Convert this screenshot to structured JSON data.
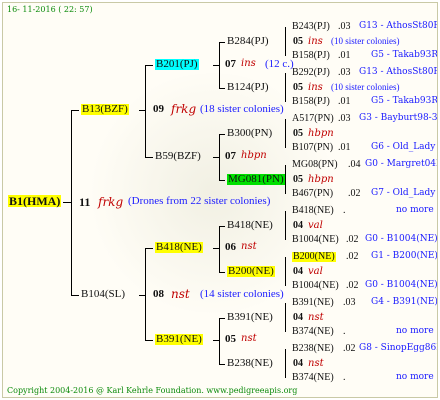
{
  "date": "16- 11-2016 ( 22: 57)",
  "footer": "Copyright 2004-2016 @ Karl Kehrle Foundation.   www.pedigreeapis.org",
  "root": {
    "id": "B1(HMA)",
    "num": "11",
    "name": "frkg",
    "note": "(Drones from 22 sister colonies)"
  },
  "gen1": [
    {
      "id": "B13(BZF)",
      "num": "09",
      "name": "frkg",
      "note": "(18 sister colonies)"
    },
    {
      "id": "B104(SL)",
      "num": "08",
      "name": "nst",
      "note": "(14 sister colonies)"
    }
  ],
  "gen2": [
    {
      "id": "B201(PJ)",
      "num": "07",
      "name": "ins",
      "note": "(12 c.)"
    },
    {
      "id": "B59(BZF)",
      "num": "07",
      "name": "hbpn",
      "note": ""
    },
    {
      "id": "B418(NE)",
      "num": "06",
      "name": "nst",
      "note": ""
    },
    {
      "id": "B391(NE)",
      "num": "05",
      "name": "nst",
      "note": ""
    }
  ],
  "gen3": [
    {
      "id": "B284(PJ)"
    },
    {
      "id": "B124(PJ)"
    },
    {
      "id": "B300(PN)"
    },
    {
      "id": "MG081(PN)"
    },
    {
      "id": "B418(NE)"
    },
    {
      "id": "B200(NE)"
    },
    {
      "id": "B391(NE)"
    },
    {
      "id": "B238(NE)"
    }
  ],
  "gen3_mid": [
    {
      "num": "05",
      "name": "ins",
      "note": "(10 sister colonies)"
    },
    {
      "num": "05",
      "name": "ins",
      "note": "(10 sister colonies)"
    },
    {
      "num": "05",
      "name": "hbpn",
      "note": ""
    },
    {
      "num": "05",
      "name": "hbpn",
      "note": ""
    },
    {
      "num": "04",
      "name": "val",
      "note": ""
    },
    {
      "num": "04",
      "name": "val",
      "note": ""
    },
    {
      "num": "04",
      "name": "nst",
      "note": ""
    },
    {
      "num": "04",
      "name": "nst",
      "note": ""
    }
  ],
  "gen4": [
    {
      "id": "B243(PJ)",
      "score": ".03",
      "ref": "G13 - AthosSt80R"
    },
    {
      "id": "B158(PJ)",
      "score": ".01",
      "ref": "G5 - Takab93R"
    },
    {
      "id": "B292(PJ)",
      "score": ".03",
      "ref": "G13 - AthosSt80R"
    },
    {
      "id": "B158(PJ)",
      "score": ".01",
      "ref": "G5 - Takab93R"
    },
    {
      "id": "A517(PN)",
      "score": ".03",
      "ref": "G3 - Bayburt98-3"
    },
    {
      "id": "B107(PN)",
      "score": ".01",
      "ref": "G6 - Old_Lady"
    },
    {
      "id": "MG08(PN)",
      "score": ".04",
      "ref": "G0 - Margret04R"
    },
    {
      "id": "B467(PN)",
      "score": ".02",
      "ref": "G7 - Old_Lady"
    },
    {
      "id": "B418(NE)",
      "score": ".",
      "ref": "no more"
    },
    {
      "id": "B1004(NE)",
      "score": ".02",
      "ref": "G0 - B1004(NE)"
    },
    {
      "id": "B200(NE)",
      "score": ".02",
      "ref": "G1 - B200(NE)"
    },
    {
      "id": "B1004(NE)",
      "score": ".02",
      "ref": "G0 - B1004(NE)"
    },
    {
      "id": "B391(NE)",
      "score": ".03",
      "ref": "G4 - B391(NE)"
    },
    {
      "id": "B374(NE)",
      "score": ".",
      "ref": "no more"
    },
    {
      "id": "B238(NE)",
      "score": ".02",
      "ref": "G8 - SinopEgg86R"
    },
    {
      "id": "B374(NE)",
      "score": ".",
      "ref": "no more"
    }
  ]
}
